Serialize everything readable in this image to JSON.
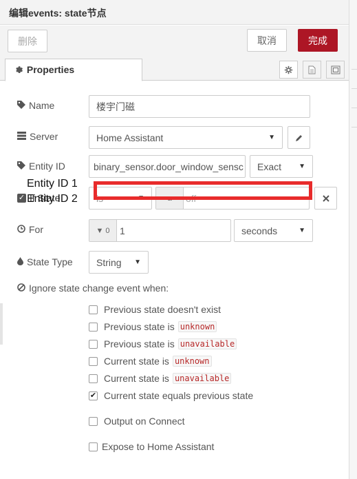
{
  "header": {
    "title": "编辑events: state节点"
  },
  "toolbar": {
    "delete_label": "删除",
    "cancel_label": "取消",
    "done_label": "完成",
    "done_color": "#ad1625"
  },
  "tabs": {
    "properties_label": "Properties",
    "icons": [
      "gear-icon",
      "document-icon",
      "frame-icon"
    ]
  },
  "form": {
    "name": {
      "label": "Name",
      "value": "楼宇门磁",
      "icon": "tag-icon"
    },
    "server": {
      "label": "Server",
      "value": "Home Assistant",
      "icon": "server-icon",
      "edit_icon": "pencil-icon"
    },
    "entity_id": {
      "label": "Entity ID",
      "value": "binary_sensor.door_window_sensc",
      "match": "Exact",
      "icon": "tag-icon"
    },
    "state_row": {
      "label": "If State",
      "operator": "is",
      "value_type_badge": "a",
      "value": "off",
      "remove_icon": "times-icon"
    },
    "for": {
      "label": "For",
      "value": "1",
      "units": "seconds",
      "type_badge": "0",
      "icon": "clock-icon"
    },
    "state_type": {
      "label": "State Type",
      "value": "String",
      "icon": "tint-icon"
    }
  },
  "ignore": {
    "label": "Ignore state change event when:",
    "icon": "ban-icon",
    "options": [
      {
        "text": "Previous state doesn't exist",
        "tag": "",
        "checked": false
      },
      {
        "text": "Previous state is",
        "tag": "unknown",
        "checked": false
      },
      {
        "text": "Previous state is",
        "tag": "unavailable",
        "checked": false
      },
      {
        "text": "Current state is",
        "tag": "unknown",
        "checked": false
      },
      {
        "text": "Current state is",
        "tag": "unavailable",
        "checked": false
      },
      {
        "text": "Current state equals previous state",
        "tag": "",
        "checked": true
      }
    ]
  },
  "output_on_connect": {
    "text": "Output on Connect",
    "checked": false
  },
  "expose": {
    "text": "Expose to Home Assistant",
    "checked": false
  },
  "overlay": {
    "line1": "Entity ID 1",
    "line2": "Entity ID 2",
    "box_color": "#e82b2b"
  }
}
